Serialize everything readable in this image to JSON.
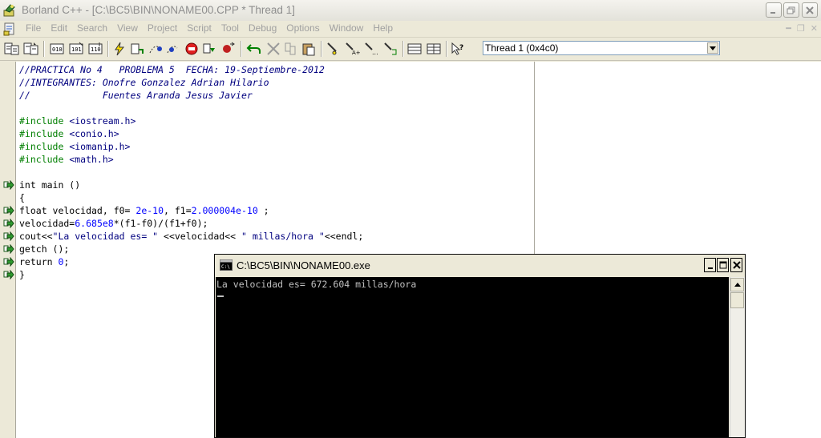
{
  "window": {
    "title": "Borland C++ - [C:\\BC5\\BIN\\NONAME00.CPP * Thread 1]"
  },
  "menu": [
    "File",
    "Edit",
    "Search",
    "View",
    "Project",
    "Script",
    "Tool",
    "Debug",
    "Options",
    "Window",
    "Help"
  ],
  "toolbar": {
    "thread_selector": "Thread 1 (0x4c0)"
  },
  "editor": {
    "lines": [
      {
        "parts": [
          {
            "t": "//PRACTICA No 4   PROBLEMA 5  FECHA: 19-Septiembre-2012",
            "c": "cm"
          }
        ]
      },
      {
        "parts": [
          {
            "t": "//INTEGRANTES: Onofre Gonzalez Adrian Hilario",
            "c": "cm"
          }
        ]
      },
      {
        "parts": [
          {
            "t": "//             Fuentes Aranda Jesus Javier",
            "c": "cm"
          }
        ]
      },
      {
        "parts": []
      },
      {
        "parts": [
          {
            "t": "#include ",
            "c": "pp"
          },
          {
            "t": "<iostream.h>",
            "c": "st"
          }
        ]
      },
      {
        "parts": [
          {
            "t": "#include ",
            "c": "pp"
          },
          {
            "t": "<conio.h>",
            "c": "st"
          }
        ]
      },
      {
        "parts": [
          {
            "t": "#include ",
            "c": "pp"
          },
          {
            "t": "<iomanip.h>",
            "c": "st"
          }
        ]
      },
      {
        "parts": [
          {
            "t": "#include ",
            "c": "pp"
          },
          {
            "t": "<math.h>",
            "c": "st"
          }
        ]
      },
      {
        "parts": []
      },
      {
        "parts": [
          {
            "t": "int main ()",
            "c": ""
          }
        ],
        "bp": true
      },
      {
        "parts": [
          {
            "t": "{",
            "c": ""
          }
        ]
      },
      {
        "parts": [
          {
            "t": "float velocidad, f0= ",
            "c": ""
          },
          {
            "t": "2e-10",
            "c": "nm"
          },
          {
            "t": ", f1=",
            "c": ""
          },
          {
            "t": "2.000004e-10",
            "c": "nm"
          },
          {
            "t": " ;",
            "c": ""
          }
        ],
        "bp": true
      },
      {
        "parts": [
          {
            "t": "velocidad=",
            "c": ""
          },
          {
            "t": "6.685e8",
            "c": "nm"
          },
          {
            "t": "*(f1-f0)/(f1+f0);",
            "c": ""
          }
        ],
        "bp": true
      },
      {
        "parts": [
          {
            "t": "cout<<",
            "c": ""
          },
          {
            "t": "\"La velocidad es= \"",
            "c": "st"
          },
          {
            "t": " <<velocidad<< ",
            "c": ""
          },
          {
            "t": "\" millas/hora \"",
            "c": "st"
          },
          {
            "t": "<<endl;",
            "c": ""
          }
        ],
        "bp": true
      },
      {
        "parts": [
          {
            "t": "getch ();",
            "c": ""
          }
        ],
        "bp": true
      },
      {
        "parts": [
          {
            "t": "return ",
            "c": ""
          },
          {
            "t": "0",
            "c": "nm"
          },
          {
            "t": ";",
            "c": ""
          }
        ],
        "bp": true
      },
      {
        "parts": [
          {
            "t": "}",
            "c": ""
          }
        ],
        "bp": true
      }
    ]
  },
  "console": {
    "title": "C:\\BC5\\BIN\\NONAME00.exe",
    "output": "La velocidad es= 672.604 millas/hora"
  }
}
